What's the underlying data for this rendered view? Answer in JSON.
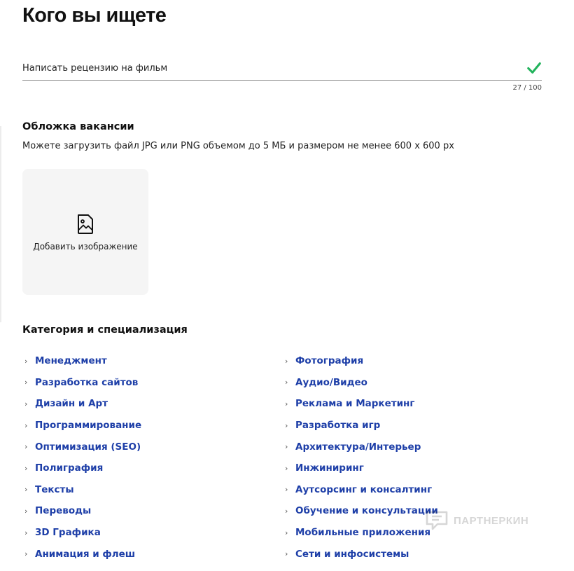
{
  "page": {
    "title": "Кого вы ищете"
  },
  "title_field": {
    "value": "Написать рецензию на фильм",
    "counter": "27 / 100",
    "check_color": "#22b35c"
  },
  "cover": {
    "heading": "Обложка вакансии",
    "hint": "Можете загрузить файл JPG или PNG объемом до 5 МБ и размером не менее 600 х 600 px",
    "upload_label": "Добавить изображение",
    "upload_icon": "image-file-icon"
  },
  "categories": {
    "heading": "Категория и специализация",
    "left": [
      "Менеджмент",
      "Разработка сайтов",
      "Дизайн и Арт",
      "Программирование",
      "Оптимизация (SEO)",
      "Полиграфия",
      "Тексты",
      "Переводы",
      "3D Графика",
      "Анимация и флеш"
    ],
    "right": [
      "Фотография",
      "Аудио/Видео",
      "Реклама и Маркетинг",
      "Разработка игр",
      "Архитектура/Интерьер",
      "Инжиниринг",
      "Аутсорсинг и консалтинг",
      "Обучение и консультации",
      "Мобильные приложения",
      "Сети и инфосистемы"
    ],
    "link_color": "#1e3fa8",
    "chevron": "›"
  },
  "watermark": {
    "text": "ПАРТНЕРКИН"
  }
}
